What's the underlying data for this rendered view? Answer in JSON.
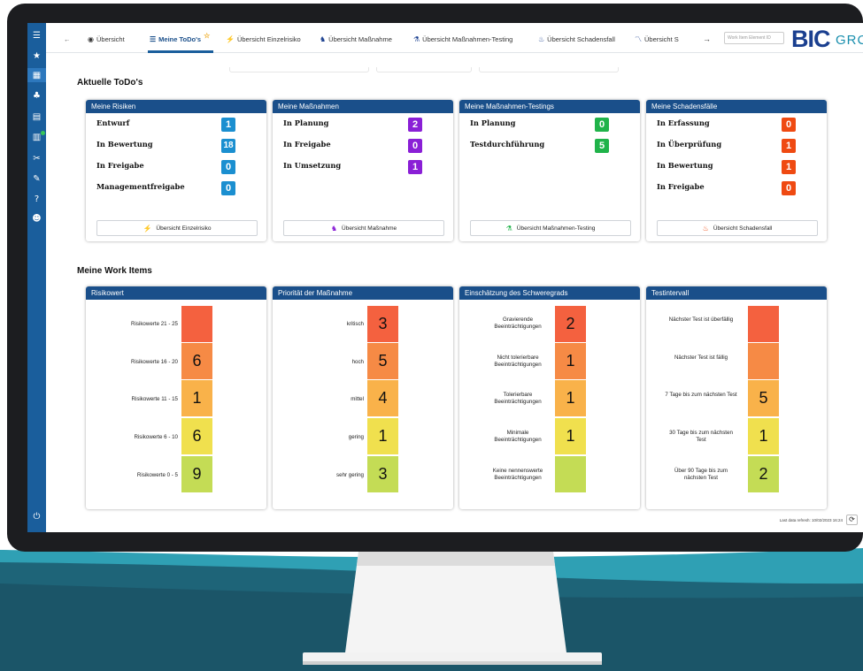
{
  "colors": {
    "sidebar": "#1a5e9c",
    "panel_header": "#1a4f8a",
    "badge_blue": "#1b8fd0",
    "badge_purple": "#8a1fd6",
    "badge_green": "#20b34a",
    "badge_orange": "#ef4a12",
    "heat_red": "#f4613f",
    "heat_orange_dark": "#f68a45",
    "heat_orange": "#f9b24a",
    "heat_yellow": "#f0e04e",
    "heat_green": "#c4dc55"
  },
  "sidebar": {
    "icons": [
      "menu-icon",
      "star-icon",
      "dashboard-icon",
      "sitemap-icon",
      "document-icon",
      "chart-icon",
      "tools-icon",
      "wrench-icon",
      "help-icon",
      "user-icon",
      "power-icon"
    ]
  },
  "topbar": {
    "tabs": [
      {
        "label": "Übersicht",
        "icon": "eye-icon"
      },
      {
        "label": "Meine ToDo's",
        "icon": "list-icon"
      },
      {
        "label": "Übersicht Einzelrisiko",
        "icon": "bolt-icon"
      },
      {
        "label": "Übersicht Maßnahme",
        "icon": "chess-icon"
      },
      {
        "label": "Übersicht Maßnahmen-Testing",
        "icon": "flask-icon"
      },
      {
        "label": "Übersicht Schadensfall",
        "icon": "fire-icon"
      },
      {
        "label": "Übersicht S",
        "icon": "chart-line-icon"
      }
    ],
    "search_placeholder": "Work Item Element ID",
    "logo_main": "BIC",
    "logo_sub": "GRC"
  },
  "todos": {
    "title": "Aktuelle ToDo's",
    "panels": [
      {
        "header": "Meine Risiken",
        "rows": [
          {
            "label": "Entwurf",
            "value": "1"
          },
          {
            "label": "In Bewertung",
            "value": "18"
          },
          {
            "label": "In Freigabe",
            "value": "0"
          },
          {
            "label": "Managementfreigabe",
            "value": "0"
          }
        ],
        "button": "Übersicht Einzelrisiko"
      },
      {
        "header": "Meine Maßnahmen",
        "rows": [
          {
            "label": "In Planung",
            "value": "2"
          },
          {
            "label": "In Freigabe",
            "value": "0"
          },
          {
            "label": "In Umsetzung",
            "value": "1"
          }
        ],
        "button": "Übersicht Maßnahme"
      },
      {
        "header": "Meine Maßnahmen-Testings",
        "rows": [
          {
            "label": "In Planung",
            "value": "0"
          },
          {
            "label": "Testdurchführung",
            "value": "5"
          }
        ],
        "button": "Übersicht Maßnahmen-Testing"
      },
      {
        "header": "Meine Schadensfälle",
        "rows": [
          {
            "label": "In Erfassung",
            "value": "0"
          },
          {
            "label": "In Überprüfung",
            "value": "1"
          },
          {
            "label": "In Bewertung",
            "value": "1"
          },
          {
            "label": "In Freigabe",
            "value": "0"
          }
        ],
        "button": "Übersicht Schadensfall"
      }
    ]
  },
  "work_items": {
    "title": "Meine Work Items",
    "panels": [
      {
        "header": "Risikowert",
        "rows": [
          {
            "label": "Risikowerte 21 - 25",
            "value": ""
          },
          {
            "label": "Risikowerte 16 - 20",
            "value": "6"
          },
          {
            "label": "Risikowerte 11 - 15",
            "value": "1"
          },
          {
            "label": "Risikowerte 6 - 10",
            "value": "6"
          },
          {
            "label": "Risikowerte 0 - 5",
            "value": "9"
          }
        ]
      },
      {
        "header": "Priorität der Maßnahme",
        "rows": [
          {
            "label": "kritisch",
            "value": "3"
          },
          {
            "label": "hoch",
            "value": "5"
          },
          {
            "label": "mittel",
            "value": "4"
          },
          {
            "label": "gering",
            "value": "1"
          },
          {
            "label": "sehr gering",
            "value": "3"
          }
        ]
      },
      {
        "header": "Einschätzung des Schweregrads",
        "rows": [
          {
            "label": "Gravierende Beeinträchtigungen",
            "value": "2"
          },
          {
            "label": "Nicht tolerierbare Beeinträchtigungen",
            "value": "1"
          },
          {
            "label": "Tolerierbare Beeinträchtigungen",
            "value": "1"
          },
          {
            "label": "Minimale Beeinträchtigungen",
            "value": "1"
          },
          {
            "label": "Keine nennenswerte Beeinträchtigungen",
            "value": ""
          }
        ]
      },
      {
        "header": "Testintervall",
        "rows": [
          {
            "label": "Nächster Test ist überfällig",
            "value": ""
          },
          {
            "label": "Nächster Test ist fällig",
            "value": ""
          },
          {
            "label": "7 Tage bis zum nächsten Test",
            "value": "5"
          },
          {
            "label": "30 Tage bis zum nächsten Test",
            "value": "1"
          },
          {
            "label": "Über 90 Tage bis zum nächsten Test",
            "value": "2"
          }
        ]
      }
    ]
  },
  "footer": {
    "refresh_text": "Last data refresh: 10/02/2023 16:24"
  }
}
